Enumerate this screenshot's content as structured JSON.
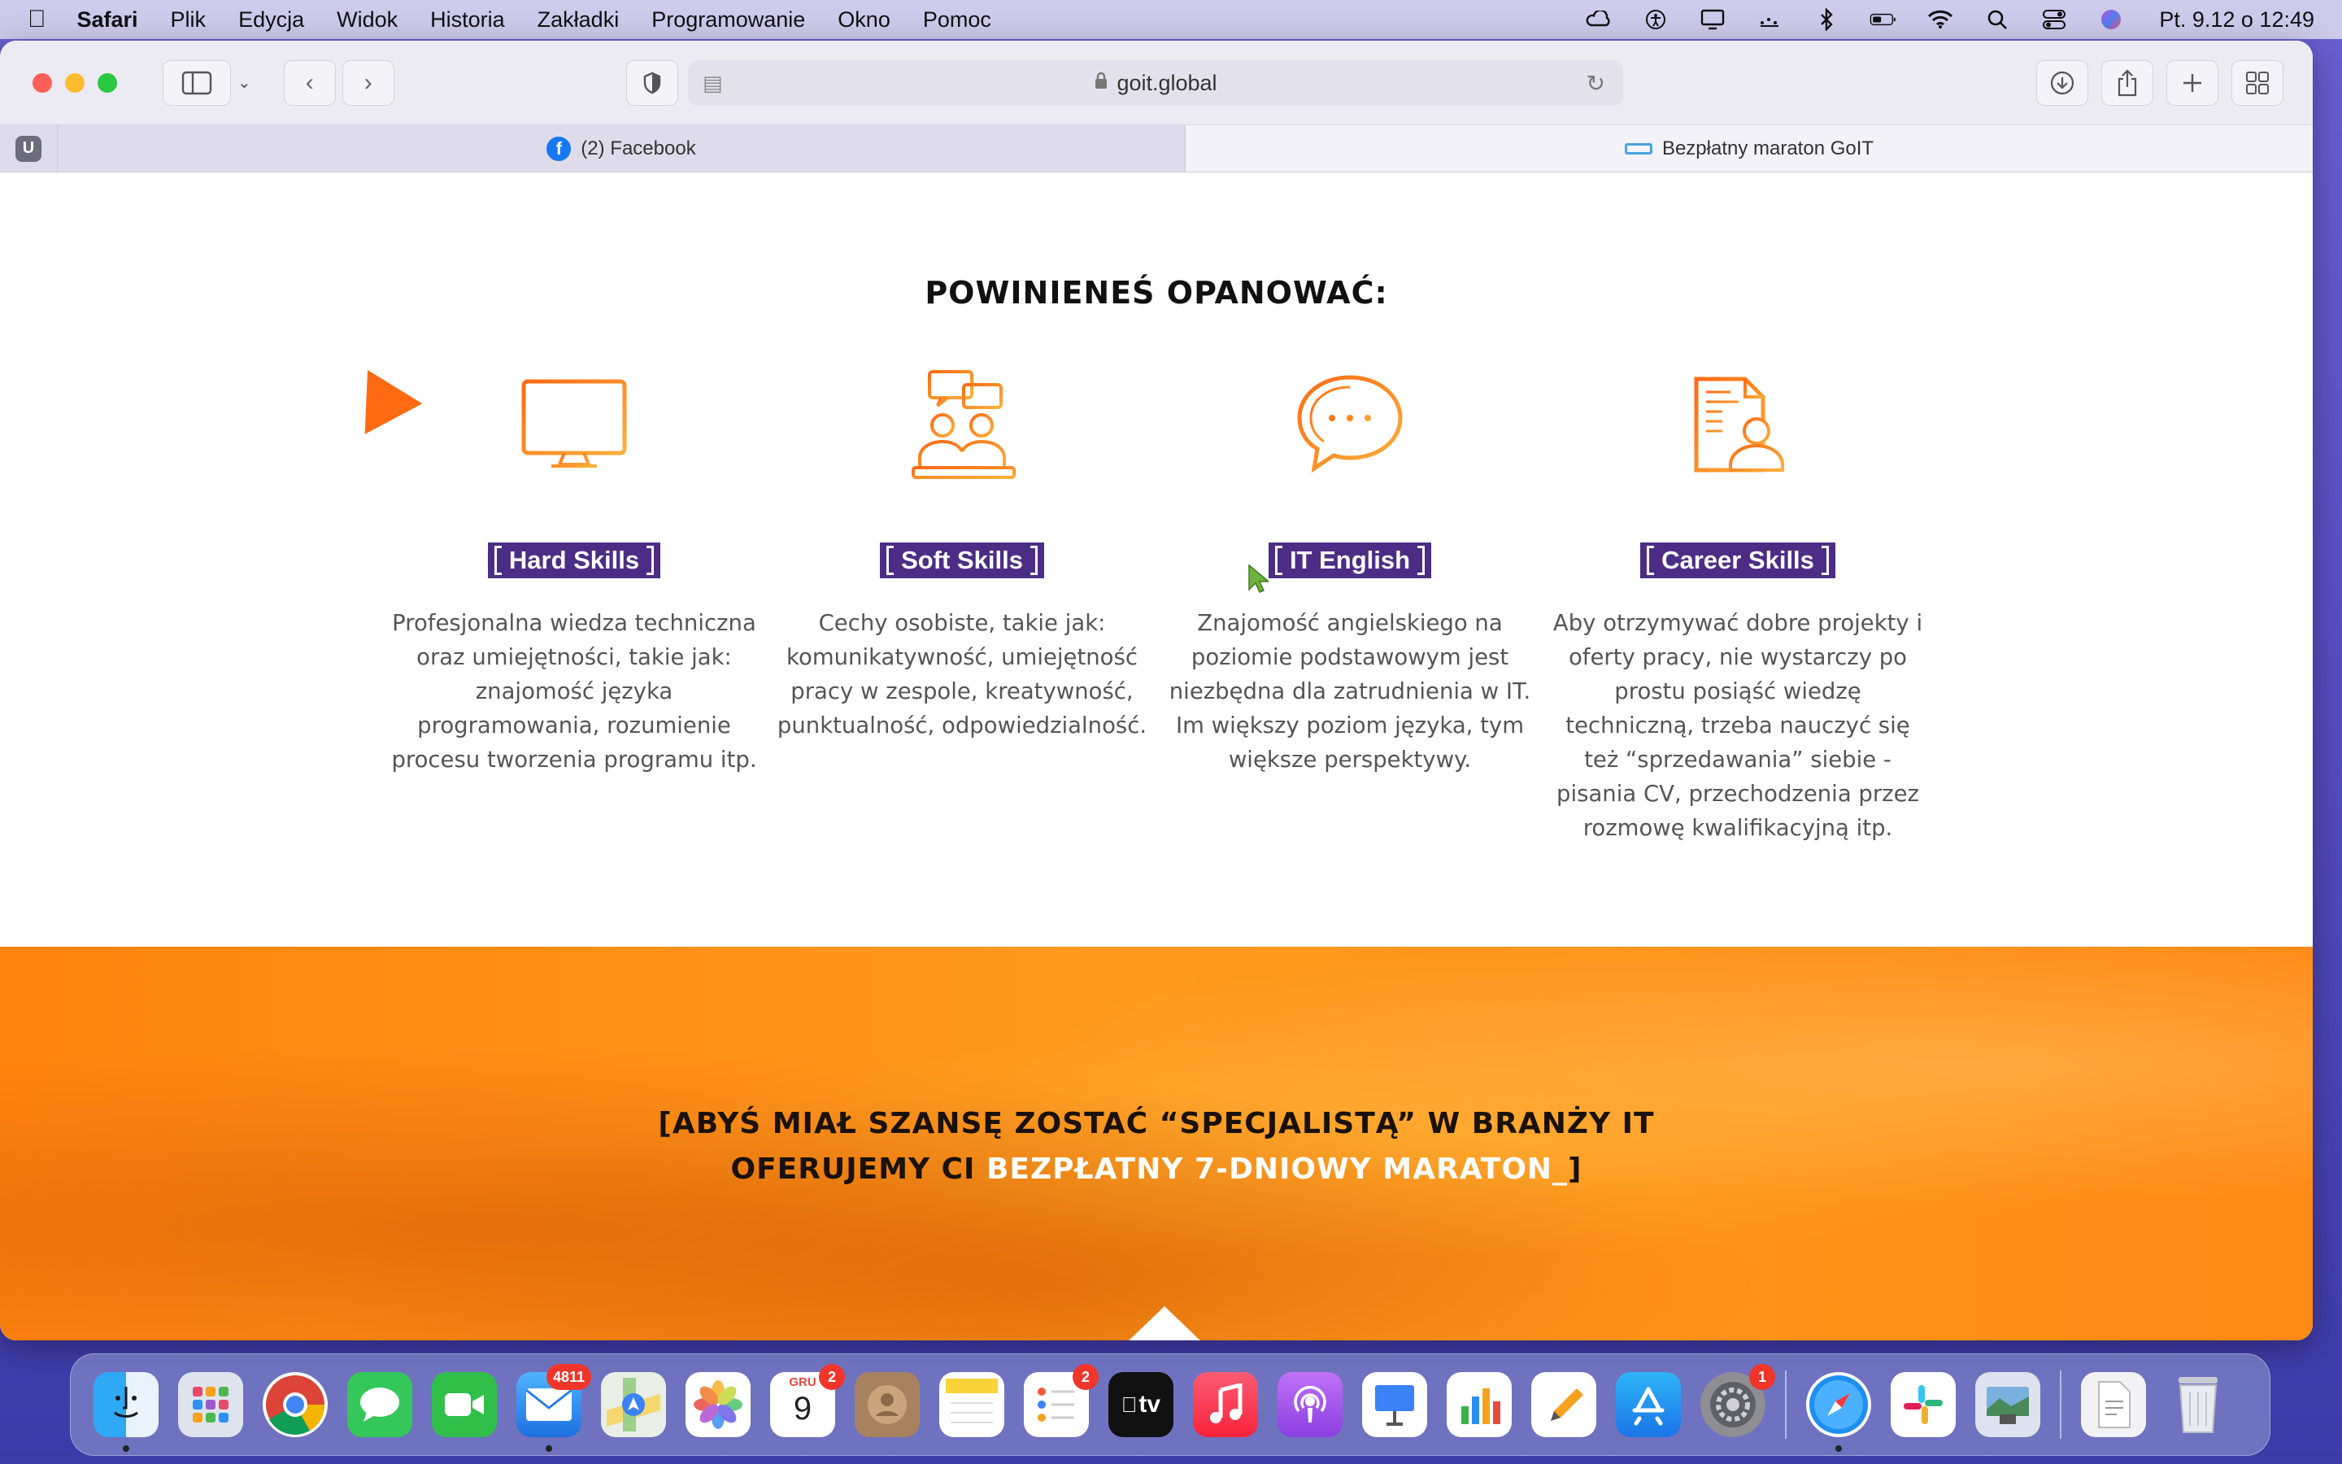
{
  "menubar": {
    "app": "Safari",
    "items": [
      "Plik",
      "Edycja",
      "Widok",
      "Historia",
      "Zakładki",
      "Programowanie",
      "Okno",
      "Pomoc"
    ],
    "clock": "Pt. 9.12 o  12:49"
  },
  "toolbar": {
    "url": "goit.global"
  },
  "tabs": [
    {
      "label": "(2) Facebook"
    },
    {
      "label": "Bezpłatny maraton GoIT"
    }
  ],
  "page": {
    "section_title": "POWINIENEŚ OPANOWAĆ:",
    "skills": [
      {
        "label": "Hard Skills",
        "icon": "monitor-icon",
        "description": "Profesjonalna wiedza techniczna oraz umiejętności, takie jak: znajomość języka programowania, rozumienie procesu tworzenia programu itp."
      },
      {
        "label": "Soft Skills",
        "icon": "people-chat-icon",
        "description": "Cechy osobiste, takie jak: komunikatywność, umiejętność pracy w zespole, kreatywność, punktualność, odpowiedzialność."
      },
      {
        "label": "IT English",
        "icon": "speech-bubble-icon",
        "description": "Znajomość angielskiego na poziomie podstawowym jest niezbędna dla zatrudnienia w IT. Im większy poziom języka, tym większe perspektywy."
      },
      {
        "label": "Career Skills",
        "icon": "resume-person-icon",
        "description": "Aby otrzymywać dobre projekty i oferty pracy, nie wystarczy po prostu posiąść wiedzę techniczną, trzeba nauczyć się też “sprzedawania” siebie - pisania CV, przechodzenia przez rozmowę kwalifikacyjną itp."
      }
    ],
    "banner": {
      "line1": "[ABYŚ MIAŁ SZANSĘ ZOSTAĆ “SPECJALISTĄ” W BRANŻY IT",
      "line2_prefix": "OFERUJEMY CI ",
      "line2_highlight": "BEZPŁATNY 7-DNIOWY MARATON_",
      "line2_suffix": "]"
    }
  },
  "dock": {
    "mail_badge": "4811",
    "calendar_month": "GRU",
    "calendar_day": "9",
    "calendar_badge": "2",
    "reminders_badge": "2",
    "settings_badge": "1",
    "tv_label": "tv"
  },
  "colors": {
    "accent_orange": "#ff8410",
    "label_purple": "#4c2d86",
    "icon_orange": "#f7931e"
  }
}
